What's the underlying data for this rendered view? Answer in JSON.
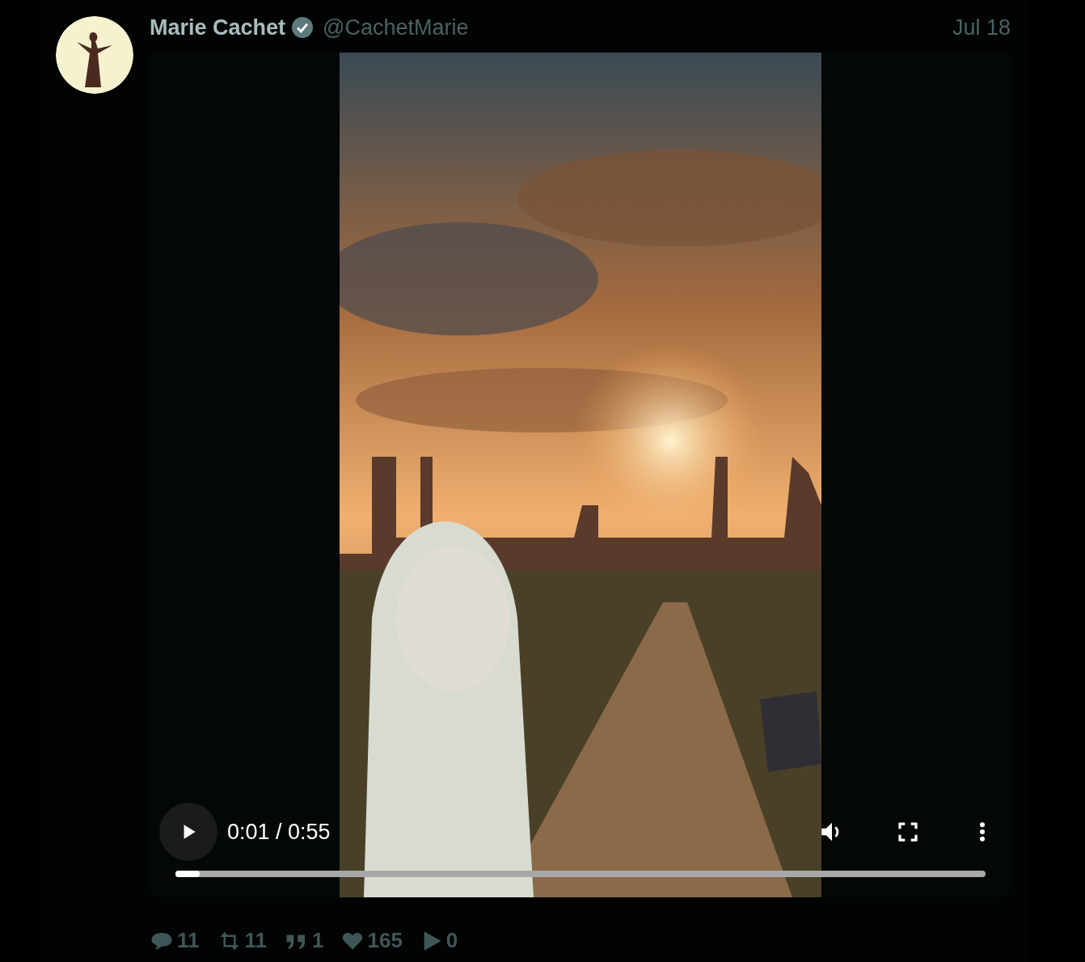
{
  "author": {
    "name": "Marie Cachet",
    "verified": true,
    "handle": "@CachetMarie"
  },
  "date": "Jul 18",
  "video": {
    "time": "0:01 / 0:55",
    "playing": false,
    "level": 0.03
  },
  "stats": [
    {
      "kind": "reply",
      "count": "11"
    },
    {
      "kind": "retweet",
      "count": "11"
    },
    {
      "kind": "quote",
      "count": "1"
    },
    {
      "kind": "like",
      "count": "165"
    },
    {
      "kind": "view",
      "count": "0"
    }
  ]
}
